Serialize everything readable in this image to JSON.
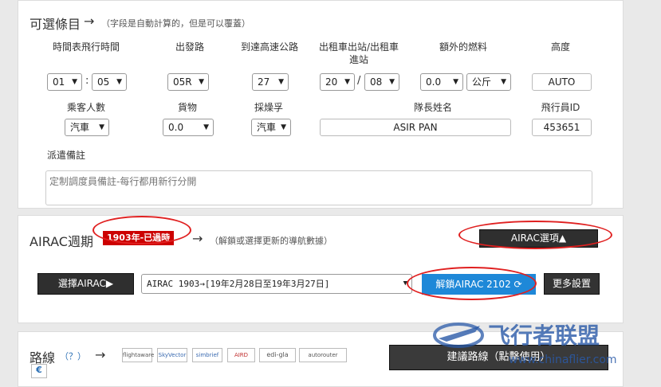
{
  "options": {
    "title": "可選條目",
    "note": "（字段是自動計算的，但是可以覆蓋）",
    "labels": {
      "sched": "時間表飛行時間",
      "dep": "出發路",
      "arr": "到達高速公路",
      "taxi": "出租車出站/出租車進站",
      "fuel": "額外的燃料",
      "alt": "高度",
      "pax": "乘客人數",
      "cargo": "貨物",
      "crew": "採燥孚",
      "captain": "隊長姓名",
      "pilotid": "飛行員ID"
    },
    "values": {
      "hour": "01",
      "min": "05",
      "dep": "05R",
      "arr": "27",
      "taxi_out": "20",
      "taxi_sep": "/",
      "taxi_in": "08",
      "fuel": "0.0",
      "fuel_unit": "公斤",
      "alt": "AUTO",
      "pax": "汽車",
      "cargo": "0.0",
      "crew": "汽車",
      "captain": "ASIR PAN",
      "pilotid": "453651"
    },
    "remarks_label": "派遣備註",
    "remarks_placeholder": "定制調度員備註-每行都用新行分開"
  },
  "airac": {
    "title": "AIRAC週期",
    "badge": "1903年-已過時",
    "note": "（解鎖或選擇更新的導航數據）",
    "options_button": "AIRAC選項▲",
    "select_button": "選擇AIRAC▶",
    "dropdown_value": "AIRAC 1903→[19年2月28日至19年3月27日]",
    "unlock_button": "解鎖AIRAC 2102",
    "more_button": "更多設置"
  },
  "route": {
    "title": "路線",
    "help": "（？）",
    "logos": [
      "flightaware",
      "SkyVector",
      "simbrief",
      "AIRD",
      "edi-gla",
      "autorouter"
    ],
    "suggest_button": "建議路線（點擊使用）"
  },
  "watermark": {
    "cn": "飞行者联盟",
    "url": "www.chinaflier.com"
  }
}
